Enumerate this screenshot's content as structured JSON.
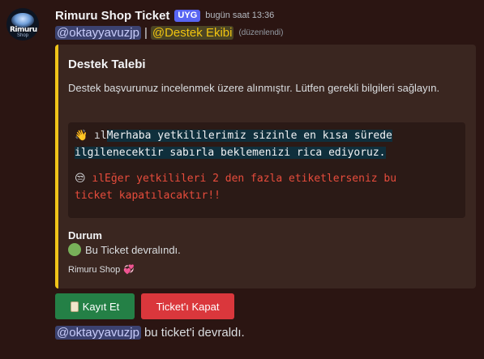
{
  "message": {
    "avatar": {
      "icon": "bot-avatar-icon",
      "line1": "Rimuru",
      "line2": "Shop"
    },
    "author": "Rimuru Shop Ticket",
    "app_tag": "UYG",
    "timestamp": "bugün saat 13:36",
    "mentions": {
      "user": "@oktayyavuzjp",
      "separator": "|",
      "role": "@Destek Ekibi",
      "edited": "(düzenlendi)"
    }
  },
  "embed": {
    "accent_color": "#f0c419",
    "title": "Destek Talebi",
    "description": "Destek başvurunuz incelenmek üzere alınmıştır. Lütfen gerekli bilgileri sağlayın.",
    "code": {
      "para1": {
        "emoji": "👋",
        "marker": "ıl",
        "line1": "Merhaba yetkililerimiz sizinle en kısa sürede",
        "line2": "ilgilenecektir sabırla beklemenizi rica ediyoruz."
      },
      "para2": {
        "emoji": "😒",
        "marker": "ıl",
        "line1": "Eğer yetkilileri 2 den fazla etiketlerseniz bu",
        "line2": "ticket kapatılacaktır!!"
      }
    },
    "field": {
      "name": "Durum",
      "value": "Bu Ticket devralındı.",
      "icon": "green-circle-icon"
    },
    "footer": {
      "text": "Rimuru Shop",
      "icon": "heart-icon"
    }
  },
  "buttons": {
    "save": {
      "label": "Kayıt Et",
      "icon": "scroll-icon",
      "color": "#248046"
    },
    "close": {
      "label": "Ticket'ı Kapat",
      "color": "#da373c"
    }
  },
  "followup": {
    "mention": "@oktayyavuzjp",
    "text": "bu ticket'i devraldı."
  }
}
